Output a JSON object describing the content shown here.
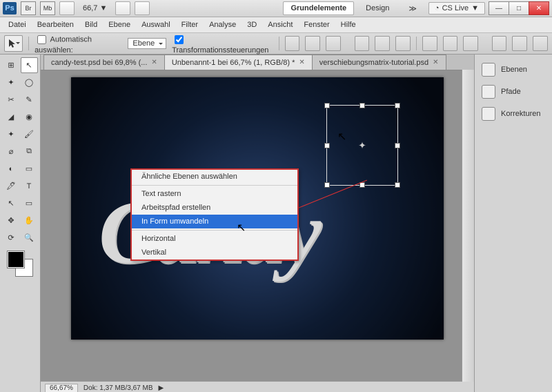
{
  "titlebar": {
    "ps": "Ps",
    "br": "Br",
    "mb": "Mb",
    "zoom": "66,7",
    "arrow": "▼",
    "mode_active": "Grundelemente",
    "mode_design": "Design",
    "more": "≫",
    "cs_icon": "◔",
    "cslive": "CS Live",
    "cs_arrow": "▼",
    "win_min": "—",
    "win_max": "□",
    "win_close": "✕"
  },
  "menu": [
    "Datei",
    "Bearbeiten",
    "Bild",
    "Ebene",
    "Auswahl",
    "Filter",
    "Analyse",
    "3D",
    "Ansicht",
    "Fenster",
    "Hilfe"
  ],
  "options": {
    "auto_label": "Automatisch auswählen:",
    "auto_checked": false,
    "dd_value": "Ebene",
    "trans_label": "Transformationssteuerungen",
    "trans_checked": true
  },
  "tabs": [
    {
      "label": "candy-test.psd bei 69,8% (...",
      "active": false
    },
    {
      "label": "Unbenannt-1 bei 66,7% (1, RGB/8) *",
      "active": true
    },
    {
      "label": "verschiebungsmatrix-tutorial.psd",
      "active": false
    }
  ],
  "tools_grid": [
    [
      "⊞",
      "↖"
    ],
    [
      "✦",
      "◯"
    ],
    [
      "✂",
      "✎"
    ],
    [
      "◢",
      "◉"
    ],
    [
      "✦",
      "🖌"
    ],
    [
      "⌀",
      "⧉"
    ],
    [
      "◐",
      "▭"
    ],
    [
      "🖊",
      "T"
    ],
    [
      "↖",
      "▭"
    ],
    [
      "✥",
      "✋"
    ],
    [
      "⟳",
      "🔍"
    ]
  ],
  "tools_selected_index": 1,
  "canvas_text": "Candy",
  "context_menu": {
    "items": [
      "Ähnliche Ebenen auswählen",
      "-",
      "Text rastern",
      "Arbeitspfad erstellen",
      "In Form umwandeln",
      "-",
      "Horizontal",
      "Vertikal"
    ],
    "highlighted": 4
  },
  "status": {
    "zoom": "66,67%",
    "doc": "Dok: 1,37 MB/3,67 MB"
  },
  "right_panel": [
    {
      "label": "Ebenen"
    },
    {
      "label": "Pfade"
    },
    {
      "label": "Korrekturen"
    }
  ]
}
